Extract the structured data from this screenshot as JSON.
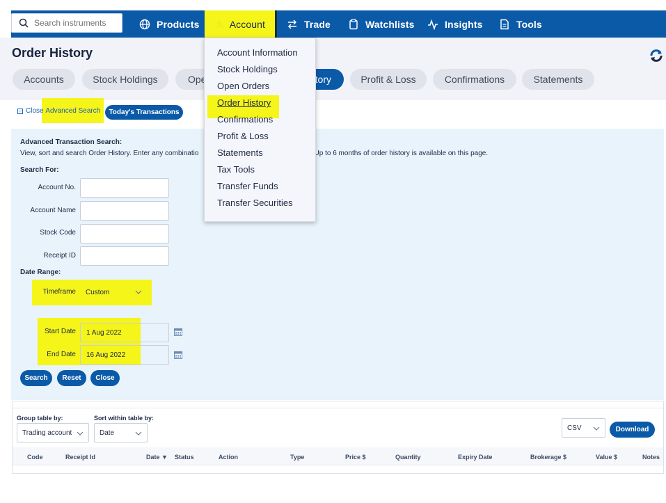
{
  "nav": {
    "search_placeholder": "Search instruments",
    "items": [
      {
        "label": "Products",
        "icon": "globe-icon"
      },
      {
        "label": "Account",
        "icon": "user-icon"
      },
      {
        "label": "Trade",
        "icon": "arrows-swap-icon"
      },
      {
        "label": "Watchlists",
        "icon": "clipboard-icon"
      },
      {
        "label": "Insights",
        "icon": "pulse-icon"
      },
      {
        "label": "Tools",
        "icon": "document-icon"
      }
    ]
  },
  "page": {
    "title": "Order History",
    "tabs": [
      "Accounts",
      "Stock Holdings",
      "Ope",
      "tory",
      "Profit & Loss",
      "Confirmations",
      "Statements"
    ]
  },
  "account_menu": {
    "items": [
      "Account Information",
      "Stock Holdings",
      "Open Orders",
      "Order History",
      "Confirmations",
      "Profit & Loss",
      "Statements",
      "Tax Tools",
      "Transfer Funds",
      "Transfer Securities"
    ]
  },
  "links": {
    "close_prefix": "Close",
    "close_advanced": "Advanced Search",
    "today": "Today's Transactions"
  },
  "advanced": {
    "title": "Advanced Transaction Search:",
    "description_left": "View, sort and search Order History. Enter any combinatio",
    "description_right": "n. Up to 6 months of order history is available on this page.",
    "search_for": "Search For:",
    "fields": [
      "Account No.",
      "Account Name",
      "Stock Code",
      "Receipt ID"
    ],
    "date_range": "Date Range:",
    "timeframe_label": "Timeframe",
    "timeframe_value": "Custom",
    "start_label": "Start Date",
    "start_value": "1 Aug 2022",
    "end_label": "End Date",
    "end_value": "16 Aug 2022",
    "buttons": [
      "Search",
      "Reset",
      "Close"
    ]
  },
  "results": {
    "group_label": "Group table by:",
    "group_value": "Trading account",
    "sort_label": "Sort within table by:",
    "sort_value": "Date",
    "format_value": "CSV",
    "download": "Download",
    "columns": [
      "Code",
      "Receipt Id",
      "Date ▼",
      "Status",
      "Action",
      "Type",
      "Price $",
      "Quantity",
      "Expiry Date",
      "Brokerage $",
      "Value $",
      "Notes"
    ]
  },
  "colors": {
    "brand_blue": "#0b5aa8",
    "highlight": "#f5f51a",
    "panel_bg": "#e8f3fb"
  }
}
